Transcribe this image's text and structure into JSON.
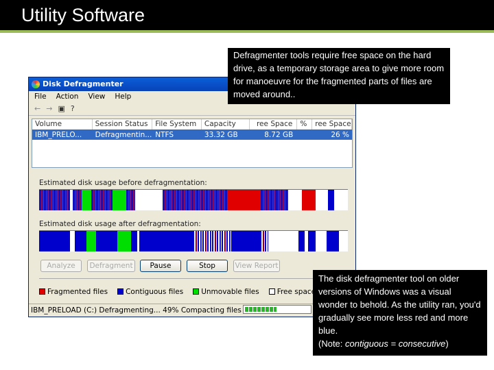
{
  "slide": {
    "title": "Utility Software"
  },
  "window": {
    "title": "Disk Defragmenter",
    "menu": [
      "File",
      "Action",
      "View",
      "Help"
    ],
    "toolbar": [
      "back-icon",
      "forward-icon",
      "properties-icon",
      "help-icon"
    ],
    "columns": [
      "Volume",
      "Session Status",
      "File System",
      "Capacity",
      "Free Space",
      "% Free Space"
    ],
    "columns_visible": [
      "Volume",
      "Session Status",
      "File System",
      "Capacity",
      "ree Space",
      "%",
      "ree Space"
    ],
    "row": [
      "IBM_PRELO...",
      "Defragmentin...",
      "NTFS",
      "33.32 GB",
      "8.72 GB",
      "26 %"
    ],
    "before_label": "Estimated disk usage before defragmentation:",
    "after_label": "Estimated disk usage after defragmentation:",
    "buttons": [
      {
        "label": "Analyze",
        "enabled": false
      },
      {
        "label": "Defragment",
        "enabled": false
      },
      {
        "label": "Pause",
        "enabled": true
      },
      {
        "label": "Stop",
        "enabled": true
      },
      {
        "label": "View Report",
        "enabled": false
      }
    ],
    "legend": [
      {
        "label": "Fragmented files",
        "color": "#e00000"
      },
      {
        "label": "Contiguous files",
        "color": "#0000cc"
      },
      {
        "label": "Unmovable files",
        "color": "#00dd00"
      },
      {
        "label": "Free space",
        "color": "#ffffff"
      }
    ],
    "status": "IBM_PRELOAD (C:) Defragmenting... 49%  Compacting files",
    "progress_percent": 49,
    "disk_map_before": [
      [
        "M",
        10
      ],
      [
        "W",
        1
      ],
      [
        "M",
        3
      ],
      [
        "U",
        3
      ],
      [
        "M",
        7
      ],
      [
        "U",
        4.5
      ],
      [
        "M",
        3
      ],
      [
        "W",
        9
      ],
      [
        "M",
        21
      ],
      [
        "F",
        11
      ],
      [
        "M",
        5
      ],
      [
        "M",
        4
      ],
      [
        "W",
        4.5
      ],
      [
        "F",
        4.5
      ],
      [
        "W",
        4
      ],
      [
        "C",
        2
      ],
      [
        "W",
        4.5
      ]
    ],
    "disk_map_after": [
      [
        "C",
        10
      ],
      [
        "W",
        1.5
      ],
      [
        "C",
        4
      ],
      [
        "U",
        3
      ],
      [
        "C",
        7
      ],
      [
        "U",
        4.5
      ],
      [
        "C",
        2
      ],
      [
        "W",
        0.5
      ],
      [
        "C",
        17.5
      ],
      [
        "S",
        13
      ],
      [
        "C",
        9
      ],
      [
        "S",
        2.5
      ],
      [
        "W",
        6.5
      ],
      [
        "W",
        3.5
      ],
      [
        "C",
        2
      ],
      [
        "W",
        1
      ],
      [
        "C",
        2.5
      ],
      [
        "W",
        3.5
      ],
      [
        "C",
        4
      ],
      [
        "W",
        3
      ]
    ]
  },
  "notes": {
    "top": "Defragmenter tools require free space on the hard drive, as a temporary storage area to give more room for manoeuvre for the fragmented parts of files are moved around..",
    "bottom_main": "The disk defragmenter tool on older versions of Windows was a visual wonder to behold. As the utility ran, you'd gradually see more less red and more blue.",
    "bottom_note_prefix": "(Note: ",
    "bottom_note_em": "contiguous = consecutive",
    "bottom_note_suffix": ")"
  }
}
